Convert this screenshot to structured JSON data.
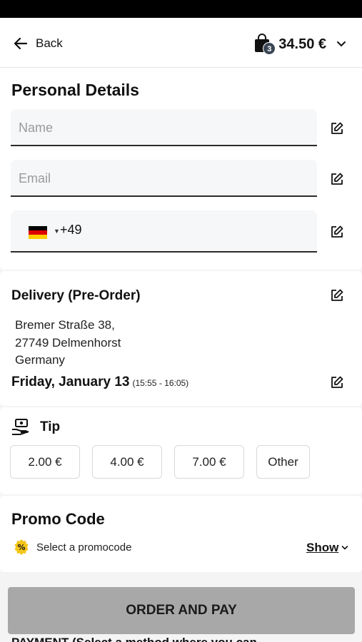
{
  "header": {
    "back_label": "Back",
    "cart_count": "3",
    "cart_total": "34.50 €"
  },
  "personal": {
    "title": "Personal Details",
    "name_placeholder": "Name",
    "email_placeholder": "Email",
    "phone_code": "+49",
    "country_flag": "germany-flag"
  },
  "delivery": {
    "title": "Delivery (Pre-Order)",
    "address_line1": "Bremer Straße 38,",
    "address_line2": "27749 Delmenhorst",
    "address_line3": "Germany",
    "date": "Friday, January 13",
    "time": "(15:55 - 16:05)"
  },
  "tip": {
    "title": "Tip",
    "options": [
      "2.00 €",
      "4.00 €",
      "7.00 €",
      "Other"
    ]
  },
  "promo": {
    "title": "Promo Code",
    "select_label": "Select a promocode",
    "show_label": "Show"
  },
  "footer": {
    "order_button": "ORDER AND PAY",
    "next_section_peek": "PAYMENT (Select a method where you can..."
  },
  "colors": {
    "order_button_bg": "#a8a8a8",
    "badge_bg": "#3b4656",
    "promo_icon": "#f5c518"
  }
}
